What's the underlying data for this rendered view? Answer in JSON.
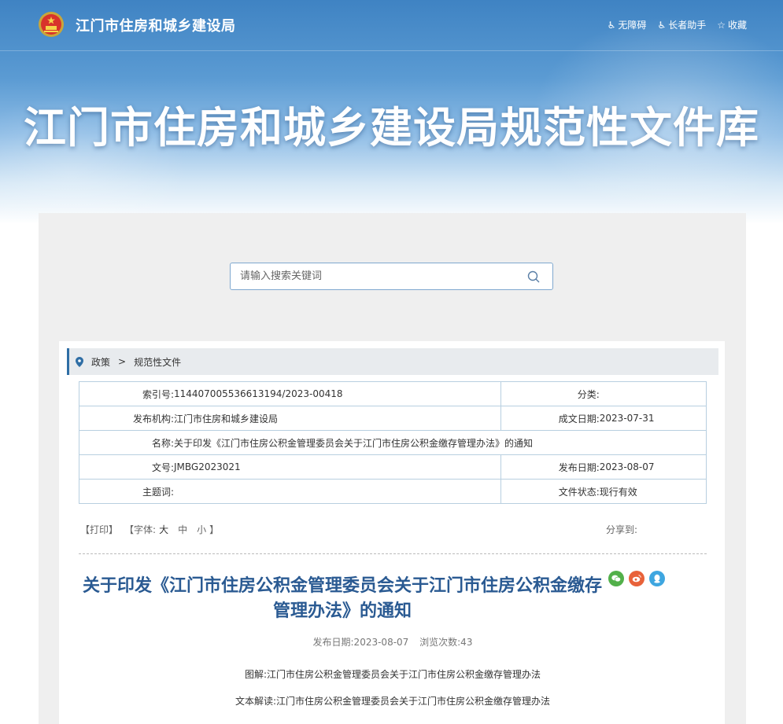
{
  "header": {
    "site_name": "江门市住房和城乡建设局",
    "tools": [
      {
        "icon": "accessibility-icon",
        "label": "无障碍"
      },
      {
        "icon": "elder-helper-icon",
        "label": "长者助手"
      },
      {
        "icon": "star-icon",
        "label": "收藏"
      }
    ],
    "banner_title": "江门市住房和城乡建设局规范性文件库"
  },
  "search": {
    "placeholder": "请输入搜索关键词"
  },
  "breadcrumb": {
    "items": [
      "政策",
      "规范性文件"
    ]
  },
  "info_table": {
    "index_label": "索引号:",
    "index_value": "114407005536613194/2023-00418",
    "category_label": "分类:",
    "category_value": "",
    "publisher_label": "发布机构:",
    "publisher_value": "江门市住房和城乡建设局",
    "written_date_label": "成文日期:",
    "written_date_value": "2023-07-31",
    "name_label": "名称:",
    "name_value": "关于印发《江门市住房公积金管理委员会关于江门市住房公积金缴存管理办法》的通知",
    "doc_no_label": "文号:",
    "doc_no_value": "JMBG2023021",
    "publish_date_label": "发布日期:",
    "publish_date_value": "2023-08-07",
    "subject_label": "主题词:",
    "subject_value": "",
    "status_label": "文件状态:",
    "status_value": "现行有效"
  },
  "article_tools": {
    "print": "【打印】",
    "font_open": "【字体:",
    "font_large": "大",
    "font_medium": "中",
    "font_small": "小",
    "font_close": "】",
    "share_label": "分享到:"
  },
  "share_icons": [
    "wechat-icon",
    "weibo-icon",
    "qq-icon"
  ],
  "article": {
    "title": "关于印发《江门市住房公积金管理委员会关于江门市住房公积金缴存管理办法》的通知",
    "publish_date": "发布日期:2023-08-07",
    "views": "浏览次数:43",
    "graphic_interp": "图解:江门市住房公积金管理委员会关于江门市住房公积金缴存管理办法",
    "text_interp": "文本解读:江门市住房公积金管理委员会关于江门市住房公积金缴存管理办法"
  },
  "colors": {
    "title_blue": "#2a5a92",
    "banner_blue": "#3f83c3",
    "wechat": "#52b04a",
    "weibo": "#e8623a",
    "qq": "#3ea6e0"
  }
}
